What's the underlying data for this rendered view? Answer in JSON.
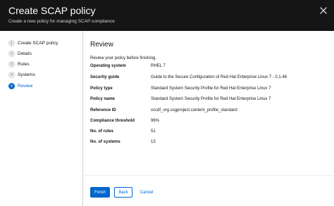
{
  "header": {
    "title": "Create SCAP policy",
    "subtitle": "Create a new policy for managing SCAP compliance"
  },
  "steps": [
    {
      "number": "1",
      "label": "Create SCAP policy"
    },
    {
      "number": "2",
      "label": "Details"
    },
    {
      "number": "3",
      "label": "Rules"
    },
    {
      "number": "4",
      "label": "Systems"
    },
    {
      "number": "5",
      "label": "Review",
      "active": true
    }
  ],
  "review": {
    "title": "Review",
    "intro": "Review your policy before finishing.",
    "rows": [
      {
        "key": "Operating system",
        "value": "RHEL 7"
      },
      {
        "key": "Security guide",
        "value": "Guide to the Secure Configuration of Red Hat Enterprise Linux 7 - 0.1.46"
      },
      {
        "key": "Policy type",
        "value": "Standard System Security Profile for Red Hat Enterprise Linux 7"
      },
      {
        "key": "Policy name",
        "value": "Standard System Security Profile for Red Hat Enterprise Linux 7"
      },
      {
        "key": "Reference ID",
        "value": "xccdf_org.ssgproject.content_profile_standard"
      },
      {
        "key": "Compliance threshold",
        "value": "96%"
      },
      {
        "key": "No. of rules",
        "value": "51"
      },
      {
        "key": "No. of systems",
        "value": "13"
      }
    ]
  },
  "footer": {
    "finish_label": "Finish",
    "back_label": "Back",
    "cancel_label": "Cancel"
  },
  "colors": {
    "header_bg": "#151515",
    "accent": "#0066cc"
  },
  "icons": {
    "close": "close-icon"
  }
}
